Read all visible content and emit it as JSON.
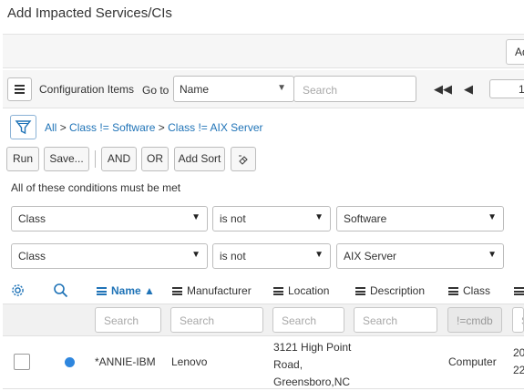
{
  "page": {
    "title": "Add Impacted Services/CIs"
  },
  "toolbar": {
    "add_label": "Add"
  },
  "list": {
    "name": "Configuration Items",
    "goto_label": "Go to",
    "goto_field": "Name",
    "search_placeholder": "Search",
    "page_value": "1"
  },
  "breadcrumb": {
    "all": "All",
    "sep": ">",
    "c1": "Class != Software",
    "c2": "Class != AIX Server"
  },
  "filter_buttons": {
    "run": "Run",
    "save": "Save...",
    "and": "AND",
    "or": "OR",
    "add_sort": "Add Sort"
  },
  "conditions": {
    "heading": "All of these conditions must be met",
    "rows": [
      {
        "field": "Class",
        "operator": "is not",
        "value": "Software"
      },
      {
        "field": "Class",
        "operator": "is not",
        "value": "AIX Server"
      }
    ]
  },
  "columns": {
    "name": "Name",
    "manufacturer": "Manufacturer",
    "location": "Location",
    "description": "Description",
    "class": "Class"
  },
  "search_row": {
    "placeholder": "Search",
    "class_filter": "!=cmdb"
  },
  "rows": [
    {
      "name": "*ANNIE-IBM",
      "manufacturer": "Lenovo",
      "location_l1": "3121 High Point",
      "location_l2": "Road,",
      "location_l3": "Greensboro,NC",
      "class": "Computer",
      "extra_l1": "20",
      "extra_l2": "22"
    }
  ],
  "colors": {
    "link": "#1f73b7",
    "status_dot": "#2e86de"
  }
}
